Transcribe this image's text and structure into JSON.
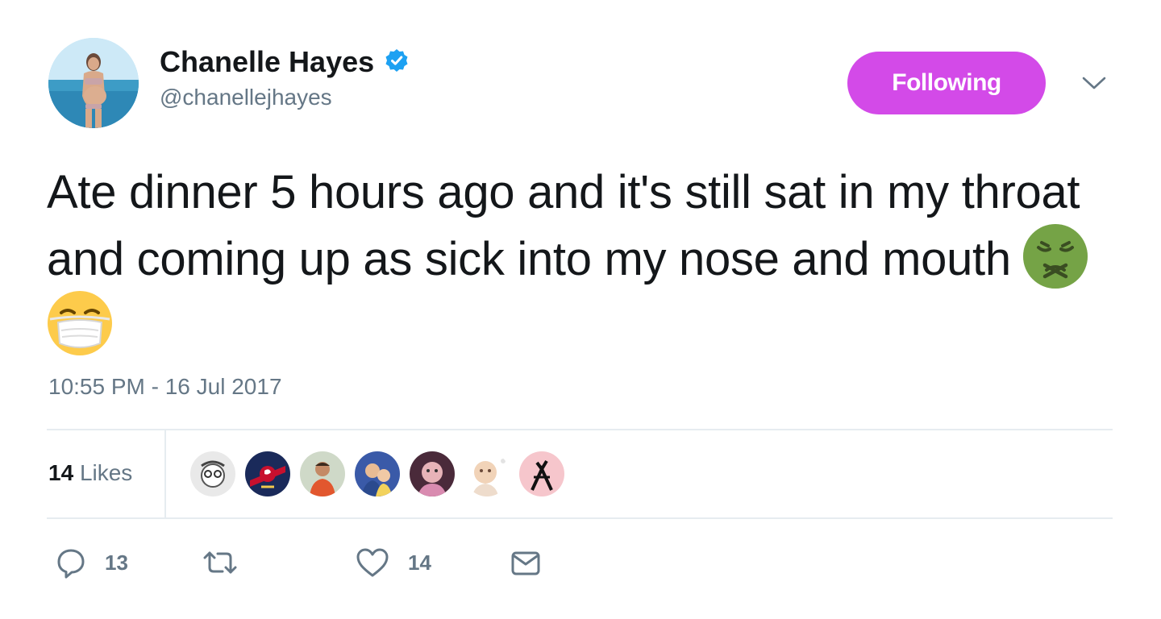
{
  "author": {
    "display_name": "Chanelle Hayes",
    "handle": "@chanellejhayes",
    "verified_icon": "verified-badge-icon",
    "avatar": "profile-photo"
  },
  "follow_button": {
    "label": "Following",
    "color": "#d34ae8"
  },
  "menu": {
    "icon": "chevron-down-icon"
  },
  "tweet": {
    "text": "Ate dinner 5 hours ago and it's still sat in my throat and coming up as sick into my nose and mouth",
    "emojis": [
      "nauseated-face-emoji",
      "face-with-medical-mask-emoji"
    ],
    "timestamp": "10:55 PM - 16 Jul 2017"
  },
  "stats": {
    "likes_count": "14",
    "likes_label": "Likes",
    "likers": [
      "liker-1",
      "liker-2",
      "liker-3",
      "liker-4",
      "liker-5",
      "liker-6",
      "liker-7"
    ]
  },
  "actions": {
    "reply": {
      "icon": "reply-icon",
      "count": "13"
    },
    "retweet": {
      "icon": "retweet-icon",
      "count": ""
    },
    "like": {
      "icon": "heart-icon",
      "count": "14"
    },
    "message": {
      "icon": "envelope-icon"
    }
  },
  "colors": {
    "text_primary": "#14171a",
    "text_secondary": "#657786",
    "divider": "#e6ecf0",
    "verified_blue": "#1da1f2"
  }
}
